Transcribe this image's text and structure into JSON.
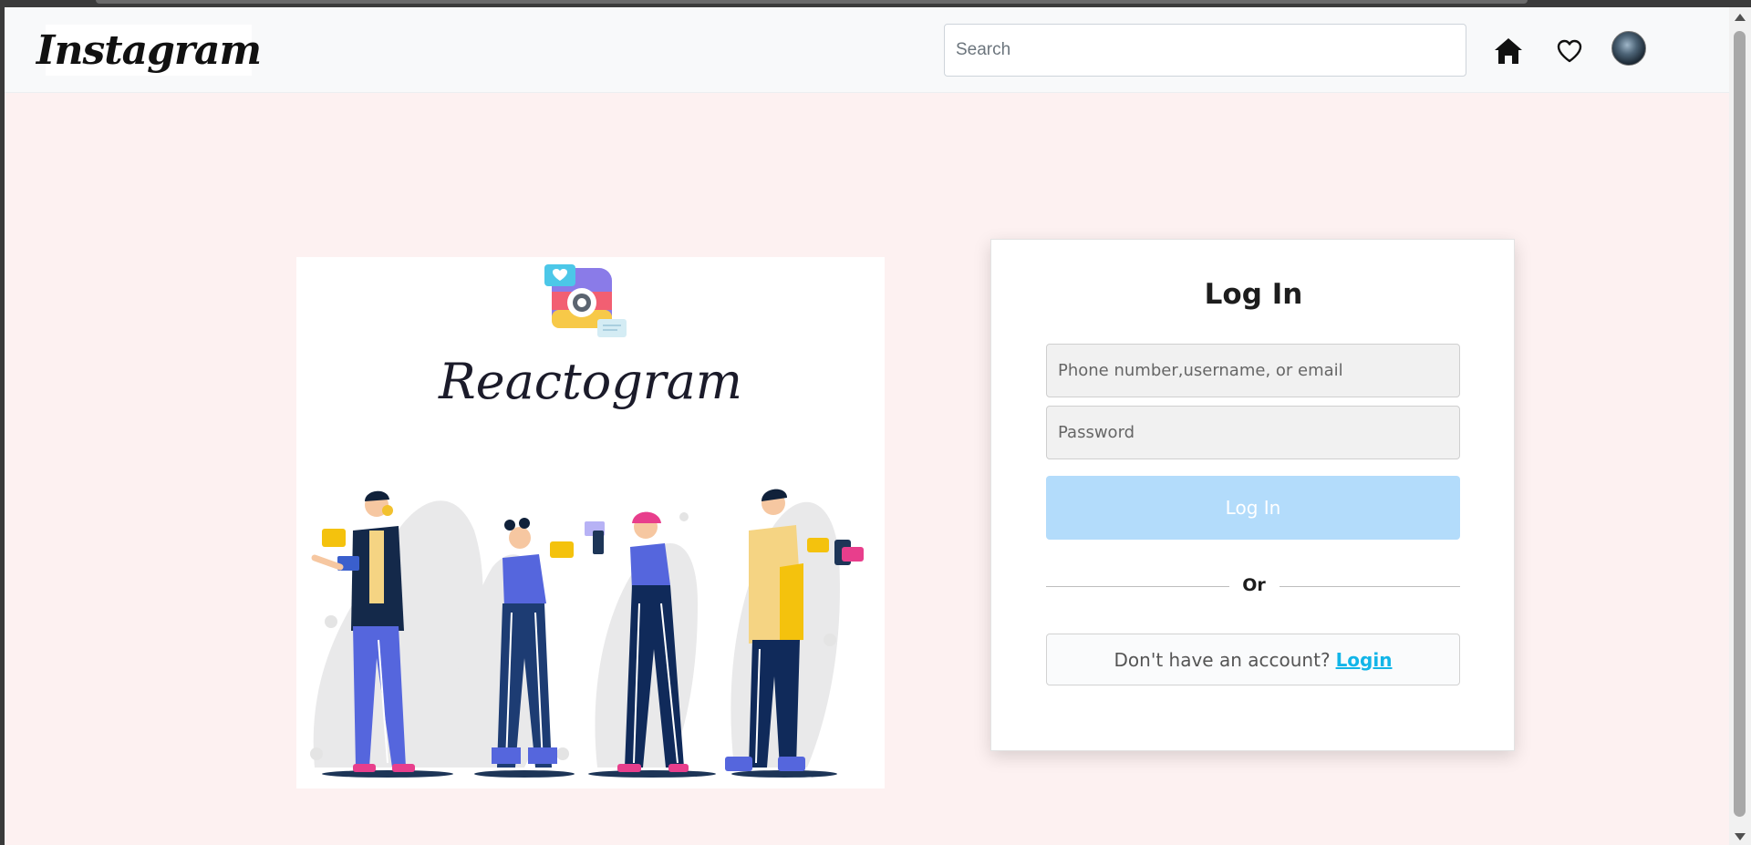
{
  "navbar": {
    "logo": "Instagram",
    "search_placeholder": "Search",
    "icons": [
      "home-icon",
      "heart-icon",
      "avatar"
    ]
  },
  "illustration": {
    "brand": "Reactogram",
    "icon_name": "instagram-camera-icon"
  },
  "login": {
    "title": "Log In",
    "identifier_placeholder": "Phone number,username, or email",
    "password_placeholder": "Password",
    "submit_label": "Log In",
    "divider": "Or",
    "signup_prompt": "Don't have an account?",
    "signup_link": "Login"
  },
  "colors": {
    "page_bg": "#fdf1f1",
    "button_bg": "#b3dcfb",
    "link": "#12b5e8"
  }
}
